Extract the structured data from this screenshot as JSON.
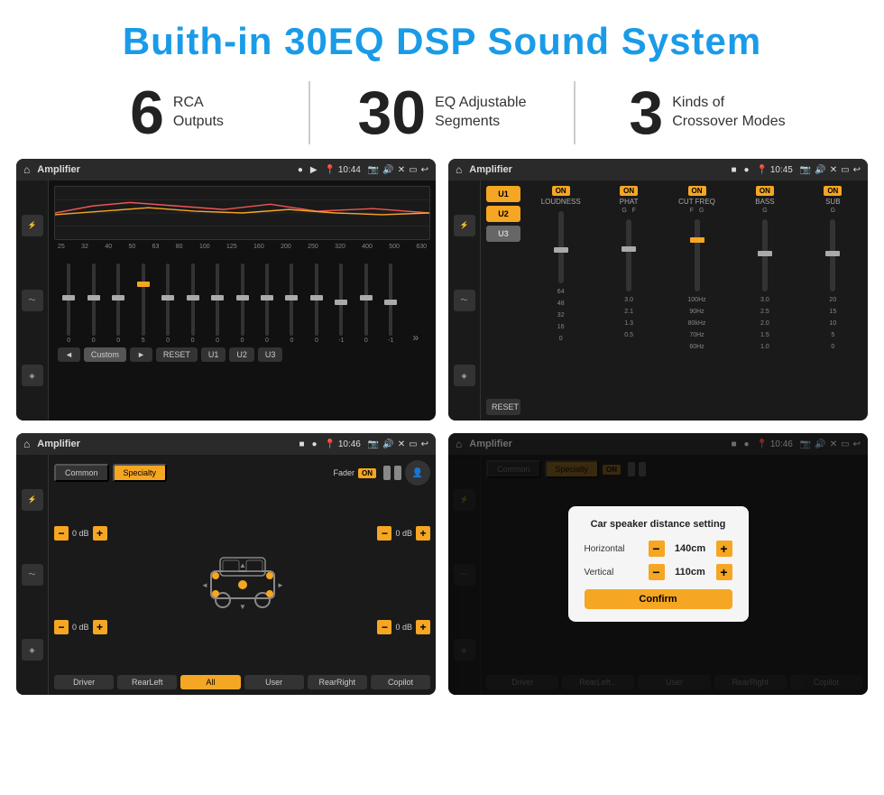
{
  "page": {
    "title": "Buith-in 30EQ DSP Sound System"
  },
  "stats": [
    {
      "number": "6",
      "label": "RCA\nOutputs"
    },
    {
      "number": "30",
      "label": "EQ Adjustable\nSegments"
    },
    {
      "number": "3",
      "label": "Kinds of\nCrossover Modes"
    }
  ],
  "screens": {
    "eq": {
      "topbar": {
        "title": "Amplifier",
        "time": "10:44"
      },
      "freq_labels": [
        "25",
        "32",
        "40",
        "50",
        "63",
        "80",
        "100",
        "125",
        "160",
        "200",
        "250",
        "320",
        "400",
        "500",
        "630"
      ],
      "slider_values": [
        "0",
        "0",
        "0",
        "5",
        "0",
        "0",
        "0",
        "0",
        "0",
        "0",
        "0",
        "-1",
        "0",
        "-1"
      ],
      "buttons": [
        "◄",
        "Custom",
        "►",
        "RESET",
        "U1",
        "U2",
        "U3"
      ]
    },
    "mixer": {
      "topbar": {
        "title": "Amplifier",
        "time": "10:45"
      },
      "channels": [
        "U1",
        "U2",
        "U3"
      ],
      "modules": [
        {
          "label": "LOUDNESS",
          "on": true
        },
        {
          "label": "PHAT",
          "on": true
        },
        {
          "label": "CUT FREQ",
          "on": true
        },
        {
          "label": "BASS",
          "on": true
        },
        {
          "label": "SUB",
          "on": true
        }
      ]
    },
    "fader": {
      "topbar": {
        "title": "Amplifier",
        "time": "10:46"
      },
      "tabs": [
        "Common",
        "Specialty"
      ],
      "fader_label": "Fader",
      "on_toggle": "ON",
      "vol_controls": [
        {
          "label": "0 dB"
        },
        {
          "label": "0 dB"
        },
        {
          "label": "0 dB"
        },
        {
          "label": "0 dB"
        }
      ],
      "bottom_buttons": [
        "Driver",
        "RearLeft",
        "All",
        "User",
        "RearRight",
        "Copilot"
      ]
    },
    "dialog": {
      "topbar": {
        "title": "Amplifier",
        "time": "10:46"
      },
      "tabs": [
        "Common",
        "Specialty"
      ],
      "dialog": {
        "title": "Car speaker distance setting",
        "horizontal_label": "Horizontal",
        "horizontal_value": "140cm",
        "vertical_label": "Vertical",
        "vertical_value": "110cm",
        "confirm_label": "Confirm"
      },
      "bottom_buttons": [
        "Driver",
        "RearLeft",
        "All",
        "User",
        "RearRight",
        "Copilot"
      ]
    }
  }
}
